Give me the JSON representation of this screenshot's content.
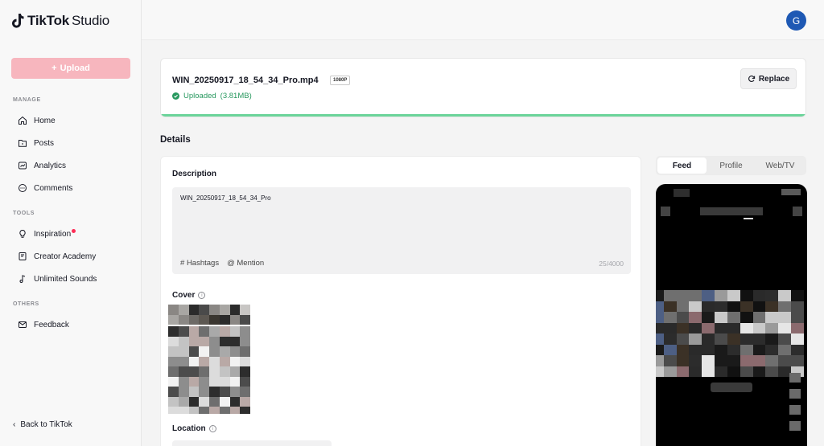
{
  "app": {
    "logo_brand": "TikTok",
    "logo_product": "Studio",
    "avatar_initial": "G"
  },
  "sidebar": {
    "upload_label": "Upload",
    "sections": {
      "manage": "MANAGE",
      "tools": "TOOLS",
      "others": "OTHERS"
    },
    "items": [
      {
        "label": "Home",
        "icon": "home-icon"
      },
      {
        "label": "Posts",
        "icon": "folder-icon"
      },
      {
        "label": "Analytics",
        "icon": "analytics-icon"
      },
      {
        "label": "Comments",
        "icon": "comment-icon"
      },
      {
        "label": "Inspiration",
        "icon": "lightbulb-icon",
        "badge": true
      },
      {
        "label": "Creator Academy",
        "icon": "book-icon"
      },
      {
        "label": "Unlimited Sounds",
        "icon": "music-note-icon"
      },
      {
        "label": "Feedback",
        "icon": "mail-icon"
      }
    ],
    "back_label": "Back to TikTok"
  },
  "file": {
    "name": "WIN_20250917_18_54_34_Pro.mp4",
    "resolution": "1080P",
    "status": "Uploaded",
    "size": "(3.81MB)",
    "progress": 1.0,
    "replace_label": "Replace"
  },
  "details": {
    "heading": "Details",
    "description_label": "Description",
    "description_value": "WIN_20250917_18_54_34_Pro",
    "hashtags_label": "Hashtags",
    "mention_label": "Mention",
    "char_count": "25/4000",
    "cover_label": "Cover",
    "location_label": "Location"
  },
  "preview": {
    "tabs": [
      "Feed",
      "Profile",
      "Web/TV"
    ],
    "active_tab": "Feed"
  },
  "colors": {
    "brand_pink": "#f7b6be",
    "success_green": "#27985e",
    "progress_green": "#6bd49a",
    "avatar_blue": "#1e59b4",
    "notification_red": "#fe2c55"
  }
}
